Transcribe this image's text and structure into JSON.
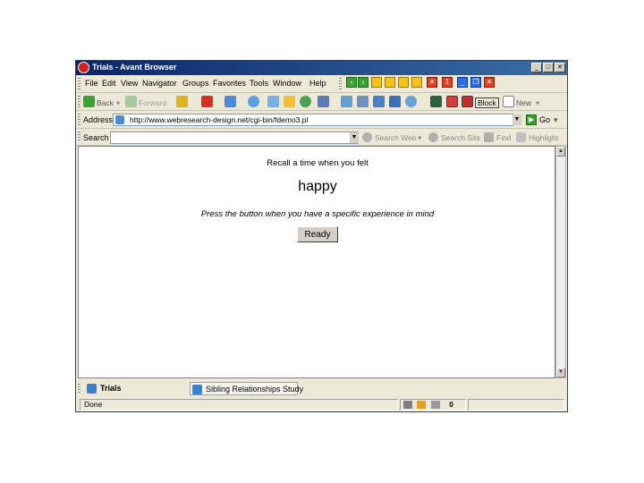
{
  "window": {
    "title": "Trials - Avant Browser"
  },
  "menu": {
    "items": [
      "File",
      "Edit",
      "View",
      "Navigator",
      "Groups",
      "Favorites",
      "Tools",
      "Window",
      "Help"
    ]
  },
  "toolbar": {
    "back_label": "Back",
    "forward_label": "Forward",
    "block_label": "Block",
    "new_label": "New"
  },
  "address": {
    "label": "Address",
    "url": "http://www.webresearch-design.net/cgi-bin/fdemo3.pl",
    "go_label": "Go"
  },
  "search": {
    "label": "Search",
    "value": "",
    "search_web_label": "Search Web",
    "search_site_label": "Search Site",
    "find_label": "Find",
    "highlight_label": "Highlight"
  },
  "page": {
    "prompt_line": "Recall a time when you felt",
    "emotion_word": "happy",
    "instruction": "Press the button when you have a specific experience in mind",
    "ready_label": "Ready"
  },
  "tabs": [
    {
      "label": "Trials"
    },
    {
      "label": "Sibling Relationships Study"
    }
  ],
  "status": {
    "text": "Done",
    "count": "0"
  },
  "colors": {
    "titlebar": "#0a246a",
    "chrome": "#ece9d8",
    "toolbar_green": "#3aa235"
  }
}
